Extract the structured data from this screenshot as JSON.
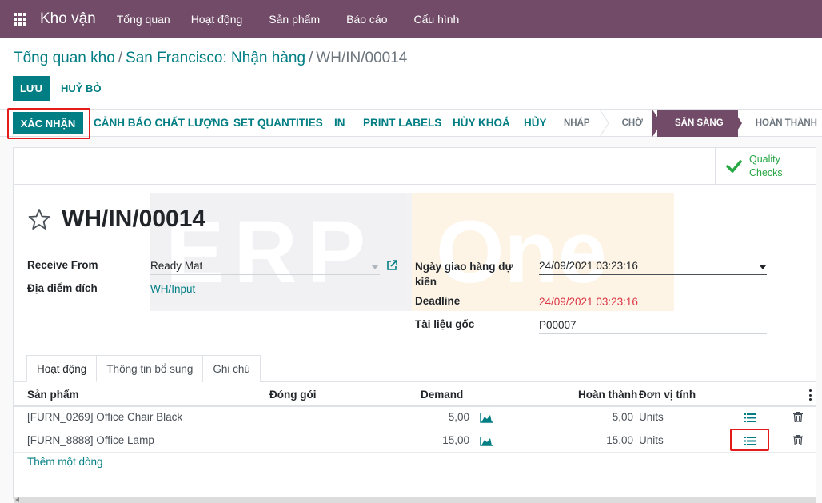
{
  "navbar": {
    "brand": "Kho vận",
    "menu": [
      "Tổng quan",
      "Hoạt động",
      "Sản phẩm",
      "Báo cáo",
      "Cấu hình"
    ]
  },
  "breadcrumb": {
    "items": [
      "Tổng quan kho",
      "San Francisco: Nhận hàng"
    ],
    "current": "WH/IN/00014"
  },
  "control": {
    "save_label": "LƯU",
    "discard_label": "HUỶ BỎ"
  },
  "statusbar": {
    "buttons": [
      "XÁC NHẬN",
      "CẢNH BÁO CHẤT LƯỢNG",
      "SET QUANTITIES",
      "IN",
      "PRINT LABELS",
      "HỦY KHOÁ",
      "HỦY"
    ],
    "stages": [
      "NHÁP",
      "CHỜ",
      "SẴN SÀNG",
      "HOÀN THÀNH"
    ],
    "active_stage": "SẴN SÀNG"
  },
  "smart_button": {
    "label_line1": "Quality",
    "label_line2": "Checks",
    "icon": "check-icon",
    "color": "#28a745"
  },
  "watermark": {
    "left": "ERP",
    "right": "One"
  },
  "record": {
    "title": "WH/IN/00014",
    "fields": {
      "receive_from_label": "Receive From",
      "receive_from_value": "Ready Mat",
      "destination_label": "Địa điểm đích",
      "destination_value": "WH/Input",
      "scheduled_label_1": "Ngày giao hàng dự",
      "scheduled_label_2": "kiến",
      "scheduled_value": "24/09/2021 03:23:16",
      "deadline_label": "Deadline",
      "deadline_value": "24/09/2021 03:23:16",
      "origin_label": "Tài liệu gốc",
      "origin_value": "P00007"
    }
  },
  "tabs": [
    "Hoạt động",
    "Thông tin bổ sung",
    "Ghi chú"
  ],
  "table": {
    "columns": [
      "Sản phẩm",
      "Đóng gói",
      "Demand",
      "Hoàn thành",
      "Đơn vị tính"
    ],
    "rows": [
      {
        "product": "[FURN_0269] Office Chair Black",
        "demand": "5,00",
        "done": "5,00",
        "uom": "Units"
      },
      {
        "product": "[FURN_8888] Office Lamp",
        "demand": "15,00",
        "done": "15,00",
        "uom": "Units"
      }
    ],
    "add_line": "Thêm một dòng"
  },
  "colors": {
    "brand": "#714b67",
    "accent": "#017e84",
    "highlight": "#e31b1b",
    "deadline": "#dc3545"
  }
}
